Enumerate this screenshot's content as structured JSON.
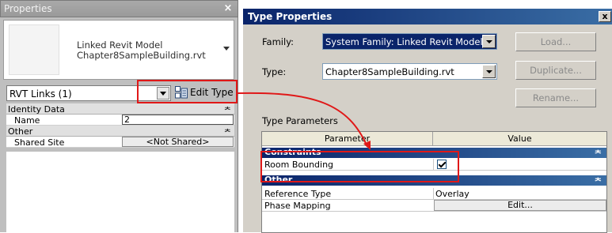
{
  "properties_panel": {
    "title": "Properties",
    "close_glyph": "×",
    "type_selector": {
      "family_label": "Linked Revit Model",
      "type_label": "Chapter8SampleBuilding.rvt"
    },
    "instance_filter": "RVT Links (1)",
    "edit_type_label": "Edit Type",
    "groups": [
      {
        "title": "Identity Data",
        "collapse": "ᄎ",
        "rows": [
          {
            "key": "Name",
            "value": "2"
          }
        ]
      },
      {
        "title": "Other",
        "collapse": "ᄎ",
        "rows": [
          {
            "key": "Shared Site",
            "value": "<Not Shared>"
          }
        ]
      }
    ]
  },
  "type_properties_dialog": {
    "title": "Type Properties",
    "close_glyph": "x",
    "family_label": "Family:",
    "family_value": "System Family: Linked Revit Model",
    "type_label": "Type:",
    "type_value": "Chapter8SampleBuilding.rvt",
    "load_button": "Load...",
    "duplicate_button": "Duplicate...",
    "rename_button": "Rename...",
    "section_label": "Type Parameters",
    "columns": {
      "parameter": "Parameter",
      "value": "Value"
    },
    "groups": [
      {
        "title": "Constraints",
        "collapse": "ᄎ",
        "rows": [
          {
            "key": "Room Bounding",
            "value_type": "checkbox",
            "checked": true
          }
        ]
      },
      {
        "title": "Other",
        "collapse": "ᄎ",
        "rows": [
          {
            "key": "Reference Type",
            "value": "Overlay"
          },
          {
            "key": "Phase Mapping",
            "value": "Edit..."
          }
        ]
      }
    ]
  },
  "colors": {
    "highlight_red": "#e01818",
    "dialog_title_blue": "#0a246a",
    "group_header_blue": "#3a6ea5"
  }
}
